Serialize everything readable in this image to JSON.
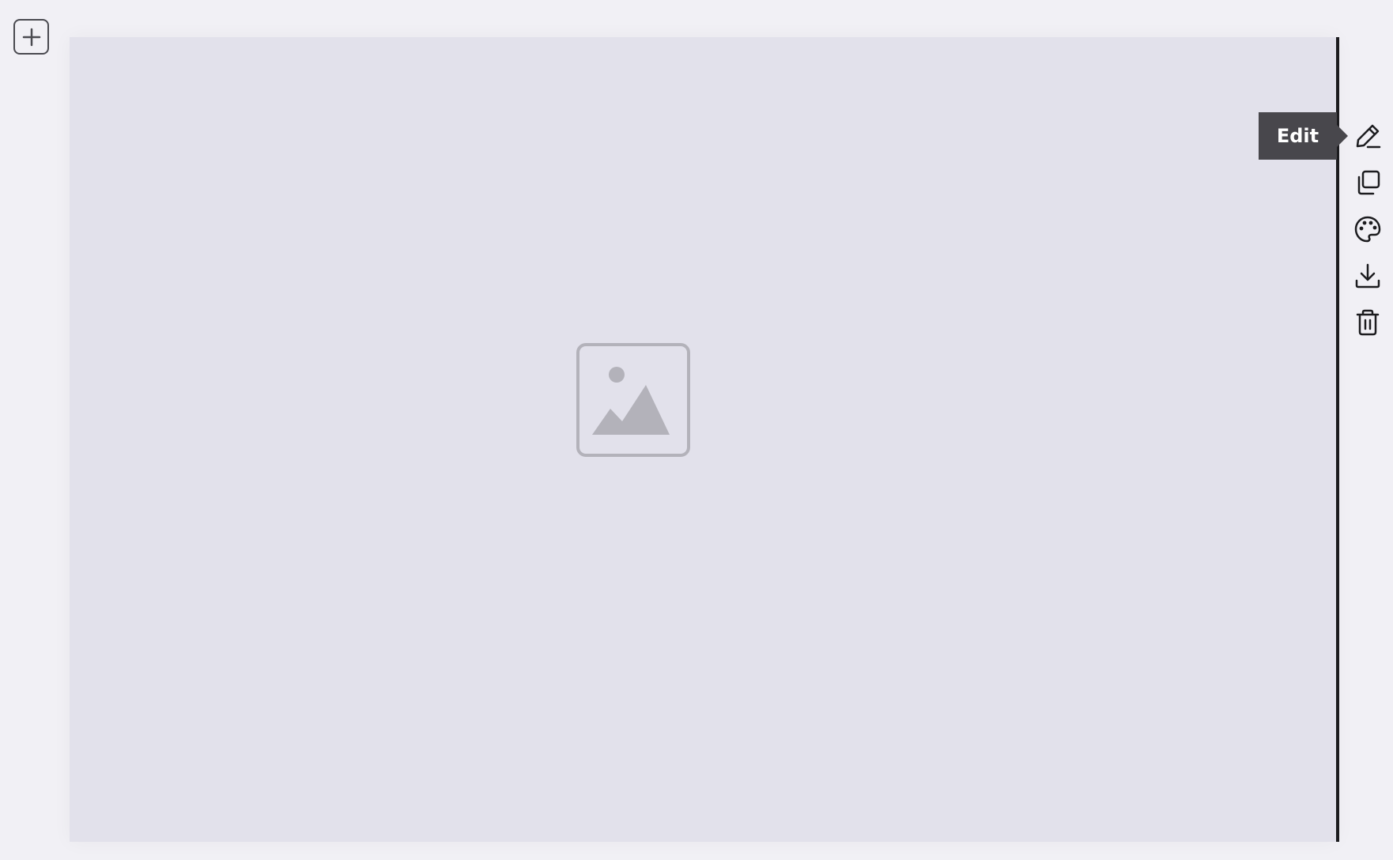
{
  "tooltip": {
    "label": "Edit"
  },
  "toolbar": {
    "items": [
      {
        "icon": "pencil-icon"
      },
      {
        "icon": "duplicate-icon"
      },
      {
        "icon": "palette-icon"
      },
      {
        "icon": "download-icon"
      },
      {
        "icon": "trash-icon"
      }
    ]
  },
  "colors": {
    "background": "#f1f0f5",
    "block_fill": "#e2e1eb",
    "placeholder_icon": "#b3b2ba",
    "tooltip_bg": "#48474c",
    "icon_stroke": "#1c1c1f"
  }
}
